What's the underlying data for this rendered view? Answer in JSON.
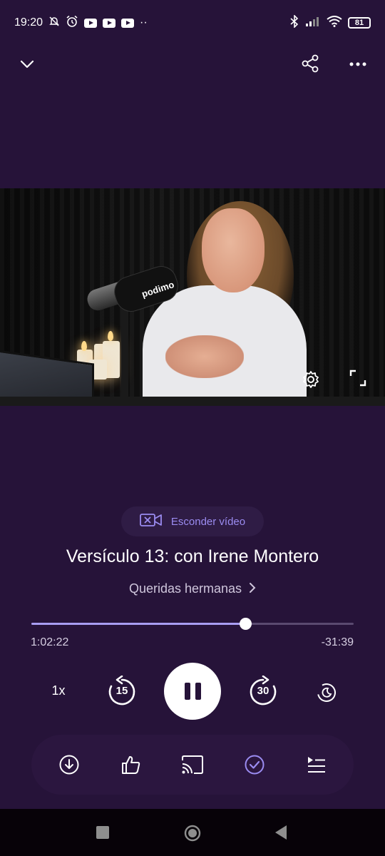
{
  "status_bar": {
    "time": "19:20",
    "battery": "81",
    "notification_icons": [
      "bell-off-icon",
      "alarm-icon",
      "youtube-icon",
      "youtube-icon",
      "youtube-icon"
    ],
    "overflow": "··",
    "system_icons": [
      "bluetooth-icon",
      "signal-icon",
      "wifi-icon",
      "battery-icon"
    ]
  },
  "top_bar": {
    "icons": [
      "chevron-down-icon",
      "share-icon",
      "more-icon"
    ]
  },
  "video": {
    "brand_label": "podimo",
    "controls": [
      "gear-icon",
      "fullscreen-icon"
    ]
  },
  "hide_video": {
    "label": "Esconder vídeo",
    "icon": "video-off-icon"
  },
  "episode": {
    "title": "Versículo 13: con Irene Montero",
    "show": "Queridas hermanas",
    "show_chevron": "›"
  },
  "progress": {
    "elapsed": "1:02:22",
    "remaining": "-31:39",
    "fraction": 0.664
  },
  "controls": {
    "speed": "1x",
    "rewind": "15",
    "forward": "30",
    "icons": [
      "rewind-15-icon",
      "pause-icon",
      "forward-30-icon",
      "sleep-timer-icon"
    ]
  },
  "actions": {
    "icons": [
      "download-icon",
      "like-icon",
      "cast-icon",
      "check-icon",
      "queue-icon"
    ]
  },
  "colors": {
    "background": "#261339",
    "accent": "#a89df2",
    "muted_text": "#cfc6dc"
  }
}
